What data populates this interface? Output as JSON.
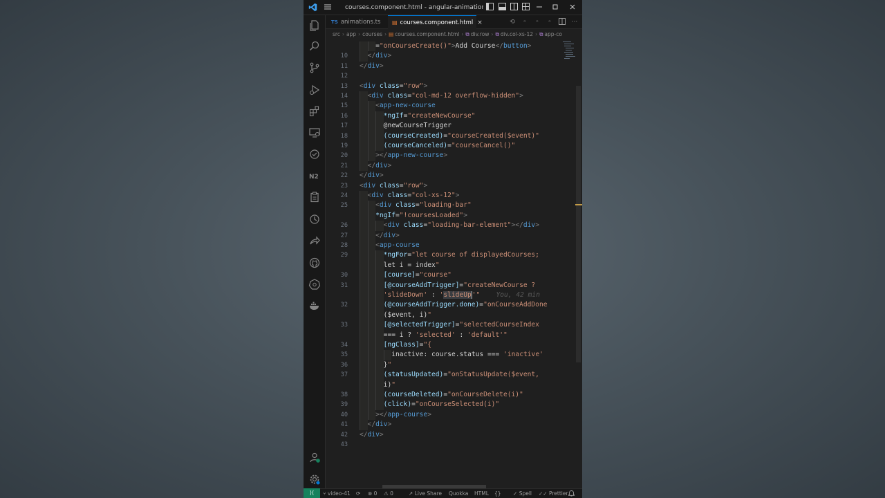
{
  "window": {
    "title": "courses.component.html - angular-animations - Vis..."
  },
  "tabs": [
    {
      "badge": "TS",
      "label": "animations.ts",
      "active": false
    },
    {
      "badge": "html",
      "label": "courses.component.html",
      "active": true,
      "close": "×"
    }
  ],
  "breadcrumbs": [
    "src",
    "app",
    "courses",
    "courses.component.html",
    "div.row",
    "div.col-xs-12",
    "app-co"
  ],
  "editor": {
    "ghost_text": "You, 42 min",
    "lines": [
      {
        "n": "",
        "indent": 2,
        "code": "=\"onCourseCreate()\">Add Course</button>"
      },
      {
        "n": "10",
        "indent": 1,
        "code": "</div>"
      },
      {
        "n": "11",
        "indent": 0,
        "code": "</div>"
      },
      {
        "n": "12",
        "indent": 0,
        "code": ""
      },
      {
        "n": "13",
        "indent": 0,
        "code": "<div class=\"row\">"
      },
      {
        "n": "14",
        "indent": 1,
        "code": "<div class=\"col-md-12 overflow-hidden\">"
      },
      {
        "n": "15",
        "indent": 2,
        "code": "<app-new-course"
      },
      {
        "n": "16",
        "indent": 3,
        "code": "*ngIf=\"createNewCourse\""
      },
      {
        "n": "17",
        "indent": 3,
        "code": "@newCourseTrigger"
      },
      {
        "n": "18",
        "indent": 3,
        "code": "(courseCreated)=\"courseCreated($event)\""
      },
      {
        "n": "19",
        "indent": 3,
        "code": "(courseCanceled)=\"courseCancel()\""
      },
      {
        "n": "20",
        "indent": 2,
        "code": "></app-new-course>"
      },
      {
        "n": "21",
        "indent": 1,
        "code": "</div>"
      },
      {
        "n": "22",
        "indent": 0,
        "code": "</div>"
      },
      {
        "n": "23",
        "indent": 0,
        "code": "<div class=\"row\">"
      },
      {
        "n": "24",
        "indent": 1,
        "code": "<div class=\"col-xs-12\">"
      },
      {
        "n": "25",
        "indent": 2,
        "code": "<div class=\"loading-bar\""
      },
      {
        "n": "",
        "indent": 2,
        "code": "*ngIf=\"!coursesLoaded\">"
      },
      {
        "n": "26",
        "indent": 3,
        "code": "<div class=\"loading-bar-element\"></div>"
      },
      {
        "n": "27",
        "indent": 2,
        "code": "</div>"
      },
      {
        "n": "28",
        "indent": 2,
        "code": "<app-course"
      },
      {
        "n": "29",
        "indent": 3,
        "code": "*ngFor=\"let course of displayedCourses;"
      },
      {
        "n": "",
        "indent": 3,
        "code": "let i = index\""
      },
      {
        "n": "30",
        "indent": 3,
        "code": "[course]=\"course\""
      },
      {
        "n": "31",
        "indent": 3,
        "code": "[@courseAddTrigger]=\"createNewCourse ?"
      },
      {
        "n": "",
        "indent": 3,
        "code": "'slideDown' : 'slideUp'\""
      },
      {
        "n": "32",
        "indent": 3,
        "code": "(@courseAddTrigger.done)=\"onCourseAddDone"
      },
      {
        "n": "",
        "indent": 3,
        "code": "($event, i)\""
      },
      {
        "n": "33",
        "indent": 3,
        "code": "[@selectedTrigger]=\"selectedCourseIndex"
      },
      {
        "n": "",
        "indent": 3,
        "code": "=== i ? 'selected' : 'default'\""
      },
      {
        "n": "34",
        "indent": 3,
        "code": "[ngClass]=\"{"
      },
      {
        "n": "35",
        "indent": 4,
        "code": "inactive: course.status === 'inactive'"
      },
      {
        "n": "36",
        "indent": 3,
        "code": "}\""
      },
      {
        "n": "37",
        "indent": 3,
        "code": "(statusUpdated)=\"onStatusUpdate($event,"
      },
      {
        "n": "",
        "indent": 3,
        "code": "i)\""
      },
      {
        "n": "38",
        "indent": 3,
        "code": "(courseDeleted)=\"onCourseDelete(i)\""
      },
      {
        "n": "39",
        "indent": 3,
        "code": "(click)=\"onCourseSelected(i)\""
      },
      {
        "n": "40",
        "indent": 2,
        "code": "></app-course>"
      },
      {
        "n": "41",
        "indent": 1,
        "code": "</div>"
      },
      {
        "n": "42",
        "indent": 0,
        "code": "</div>"
      },
      {
        "n": "43",
        "indent": 0,
        "code": ""
      }
    ]
  },
  "statusbar": {
    "remote": "⟩⟨",
    "branch": "video-41",
    "sync": "⟳",
    "errors": "⊗ 0",
    "warnings": "⚠ 0",
    "live_share": "Live Share",
    "quokka": "Quokka",
    "language": "HTML",
    "spell": "Spell",
    "prettier": "Prettier",
    "bell": "🔔"
  },
  "colors": {
    "accent": "#0078d4",
    "remote": "#16825d",
    "tag": "#569cd6",
    "attr": "#9cdcfe",
    "string": "#ce9178"
  }
}
